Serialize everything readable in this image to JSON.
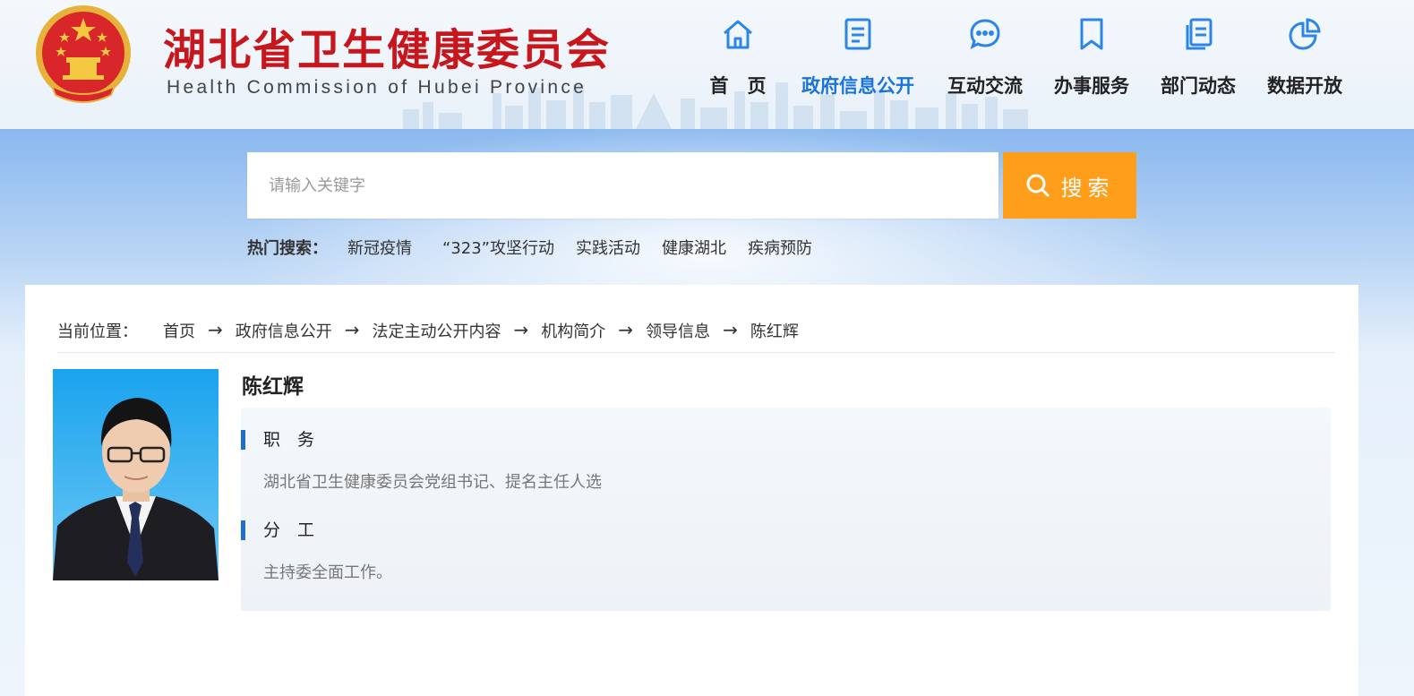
{
  "header": {
    "title": "湖北省卫生健康委员会",
    "subtitle": "Health Commission of Hubei Province"
  },
  "nav": {
    "items": [
      {
        "label": "首　页",
        "icon": "home-icon"
      },
      {
        "label": "政府信息公开",
        "icon": "document-list-icon",
        "active": true
      },
      {
        "label": "互动交流",
        "icon": "chat-bubble-icon"
      },
      {
        "label": "办事服务",
        "icon": "bookmark-icon"
      },
      {
        "label": "部门动态",
        "icon": "pages-icon"
      },
      {
        "label": "数据开放",
        "icon": "pie-chart-icon"
      }
    ]
  },
  "search": {
    "placeholder": "请输入关键字",
    "button_label": "搜索"
  },
  "hot_search": {
    "label": "热门搜索：",
    "items": [
      "新冠疫情",
      "“323”攻坚行动",
      "实践活动",
      "健康湖北",
      "疾病预防"
    ]
  },
  "breadcrumb": {
    "label": "当前位置：",
    "items": [
      "首页",
      "政府信息公开",
      "法定主动公开内容",
      "机构简介",
      "领导信息",
      "陈红辉"
    ],
    "separator": "→"
  },
  "profile": {
    "name": "陈红辉",
    "sections": [
      {
        "heading": "职　务",
        "text": "湖北省卫生健康委员会党组书记、提名主任人选"
      },
      {
        "heading": "分　工",
        "text": "主持委全面工作。"
      }
    ]
  },
  "colors": {
    "brand_red": "#c8161d",
    "nav_active": "#1a73d9",
    "search_button": "#ff9e1b",
    "section_bar": "#1f6fc9"
  }
}
